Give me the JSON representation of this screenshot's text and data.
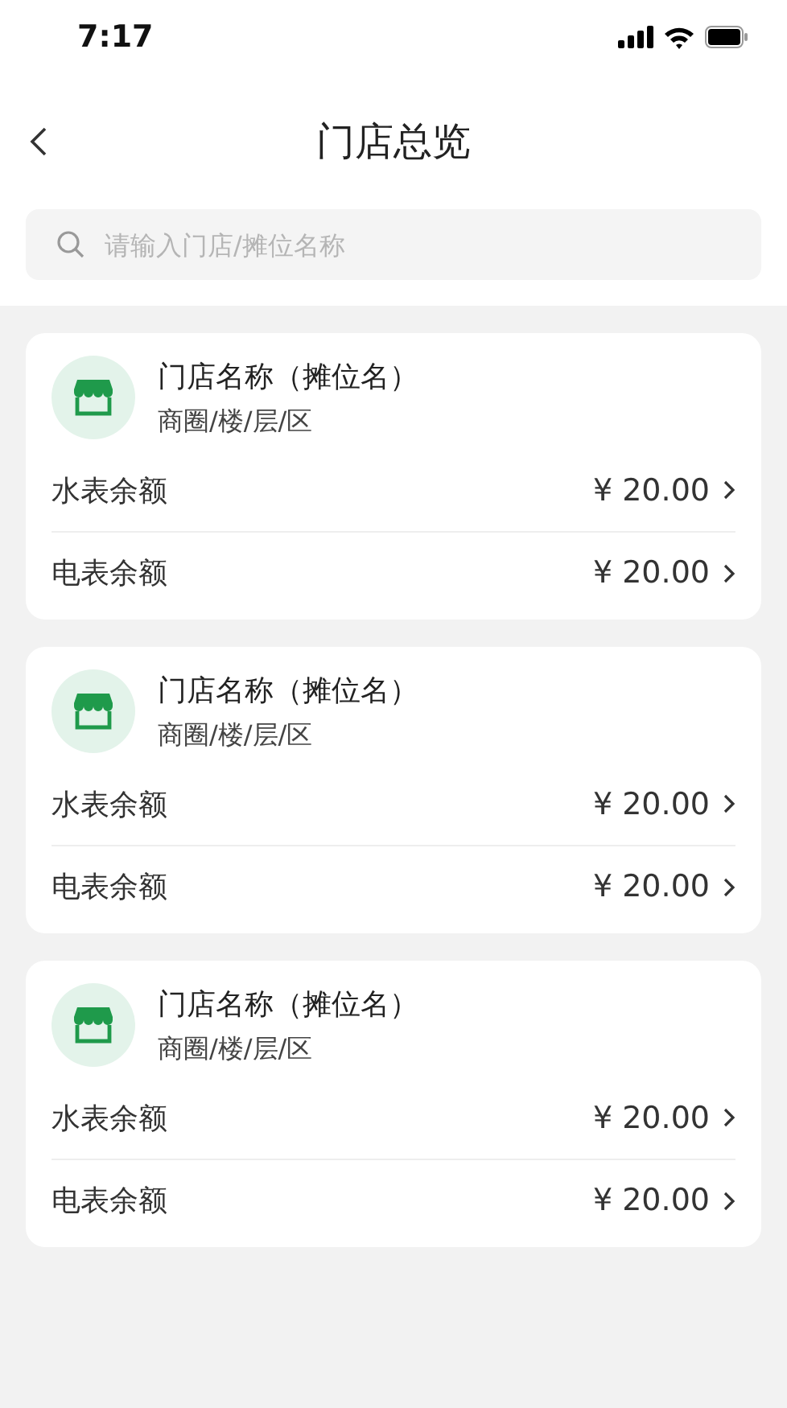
{
  "status_bar": {
    "time": "7:17"
  },
  "header": {
    "title": "门店总览"
  },
  "search": {
    "placeholder": "请输入门店/摊位名称"
  },
  "stores": [
    {
      "name": "门店名称（摊位名）",
      "location": "商圈/楼/层/区",
      "balances": [
        {
          "label": "水表余额",
          "amount": "¥ 20.00"
        },
        {
          "label": "电表余额",
          "amount": "¥ 20.00"
        }
      ]
    },
    {
      "name": "门店名称（摊位名）",
      "location": "商圈/楼/层/区",
      "balances": [
        {
          "label": "水表余额",
          "amount": "¥ 20.00"
        },
        {
          "label": "电表余额",
          "amount": "¥ 20.00"
        }
      ]
    },
    {
      "name": "门店名称（摊位名）",
      "location": "商圈/楼/层/区",
      "balances": [
        {
          "label": "水表余额",
          "amount": "¥ 20.00"
        },
        {
          "label": "电表余额",
          "amount": "¥ 20.00"
        }
      ]
    }
  ]
}
